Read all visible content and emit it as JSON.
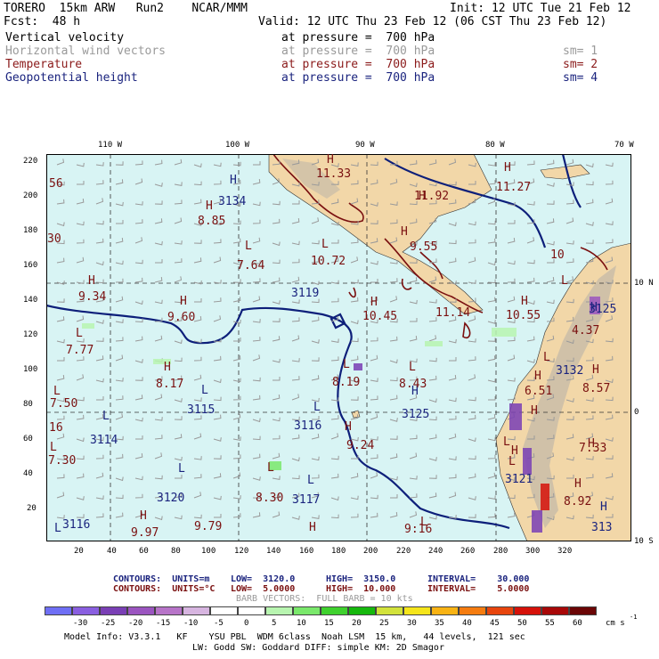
{
  "header": {
    "model": "TORERO  15km ARW   Run2    NCAR/MMM",
    "init": "Init: 12 UTC Tue 21 Feb 12",
    "fcst": "Fcst:  48 h",
    "valid": "Valid: 12 UTC Thu 23 Feb 12 (06 CST Thu 23 Feb 12)"
  },
  "fields": [
    {
      "name": "Vertical velocity",
      "level": "at pressure =  700 hPa",
      "sm": "",
      "color": "#000000"
    },
    {
      "name": "Horizontal wind vectors",
      "level": "at pressure =  700 hPa",
      "sm": "sm= 1",
      "color": "#9a9a9a"
    },
    {
      "name": "Temperature",
      "level": "at pressure =  700 hPa",
      "sm": "sm= 2",
      "color": "#8b1a1a"
    },
    {
      "name": "Geopotential height",
      "level": "at pressure =  700 hPa",
      "sm": "sm= 4",
      "color": "#1a237e"
    }
  ],
  "colors": {
    "ocean": "#d8f4f4",
    "land": "#f2d7a8",
    "height_contour": "#0d1f7a",
    "temp_contour": "#7a1010",
    "barb": "#9a9a9a"
  },
  "axes": {
    "lon_labels": [
      "110 W",
      "100 W",
      "90 W",
      "80 W",
      "70 W"
    ],
    "lat_labels": [
      "10 N",
      "0",
      "10 S"
    ],
    "x_ticks": [
      "20",
      "40",
      "60",
      "80",
      "100",
      "120",
      "140",
      "160",
      "180",
      "200",
      "220",
      "240",
      "260",
      "280",
      "300",
      "320"
    ],
    "y_ticks": [
      "220",
      "200",
      "180",
      "160",
      "140",
      "120",
      "100",
      "80",
      "60",
      "40",
      "20"
    ]
  },
  "map_labels": {
    "highs": [
      "H",
      "H",
      "H",
      "H",
      "H",
      "H",
      "H",
      "H",
      "H",
      "H",
      "H",
      "H",
      "H",
      "H",
      "H",
      "H",
      "H",
      "H",
      "H",
      "H",
      "H",
      "H",
      "H"
    ],
    "lows": [
      "L",
      "L",
      "L",
      "L",
      "L",
      "L",
      "L",
      "L",
      "L",
      "L",
      "L",
      "L",
      "L",
      "L",
      "L",
      "L",
      "L",
      "L",
      "L"
    ],
    "heights": [
      "3134",
      "3119",
      "3115",
      "3116",
      "3125",
      "3114",
      "3120",
      "3117",
      "3116",
      "3132",
      "3125",
      "3121",
      "313"
    ],
    "temps": [
      "11.33",
      "11.92",
      "11.27",
      "8.85",
      "10",
      "9.55",
      "7.64",
      "10.72",
      "9.34",
      "9.60",
      "10.45",
      "11.14",
      "10.55",
      "4.37",
      "7.77",
      "8.17",
      "8.19",
      "8.43",
      "6.51",
      "8.57",
      "7.50",
      "9.24",
      "7.30",
      "7.33",
      "8.30",
      "8.92",
      "9.97",
      "9.79",
      "9:16",
      "56",
      "30",
      "16"
    ]
  },
  "footer": {
    "contours1_label": "CONTOURS:  UNITS=m",
    "contours1_low": "LOW=  3120.0",
    "contours1_high": "HIGH=  3150.0",
    "contours1_interval": "INTERVAL=    30.000",
    "contours2_label": "CONTOURS:  UNITS=°C",
    "contours2_low": "LOW=  5.0000",
    "contours2_high": "HIGH=  10.000",
    "contours2_interval": "INTERVAL=    5.0000",
    "barb": "BARB VECTORS:  FULL BARB = 10 kts",
    "colorbar_values": [
      "-30",
      "-25",
      "-20",
      "-15",
      "-10",
      "-5",
      "0",
      "5",
      "10",
      "15",
      "20",
      "25",
      "30",
      "35",
      "40",
      "45",
      "50",
      "55",
      "60"
    ],
    "colorbar_units": "cm s",
    "colorbar_exp": "-1",
    "model_info": "Model Info: V3.3.1   KF    YSU PBL  WDM 6class  Noah LSM  15 km,   44 levels,  121 sec",
    "model_info2": "LW: Godd SW: Goddard DIFF: simple KM: 2D Smagor"
  },
  "colorbar_colors": [
    "#6f6ff5",
    "#8a5fe0",
    "#7a3fb5",
    "#9b55c0",
    "#b774c8",
    "#d7b5e0",
    "#ffffff",
    "#ffffff",
    "#b8f5b0",
    "#7ae86b",
    "#3fd12e",
    "#16b80d",
    "#d2e23b",
    "#f5e51b",
    "#f8b314",
    "#f57c10",
    "#e8450d",
    "#d6120a",
    "#a80808",
    "#6b0606"
  ]
}
